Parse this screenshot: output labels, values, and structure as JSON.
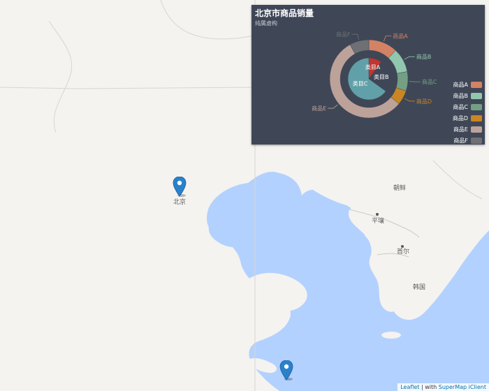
{
  "map": {
    "labels": {
      "beijing": "北京",
      "korea_north": "朝鲜",
      "pyongyang": "平壤",
      "seoul": "首尔",
      "korea_south": "韩国"
    },
    "markers": [
      "map-marker-icon",
      "map-marker-icon"
    ],
    "colors": {
      "land": "#f4f3f0",
      "sea": "#b3d1ff",
      "border": "#d7d5cf"
    }
  },
  "panel": {
    "title": "北京市商品销量",
    "subtitle": "纯属虚构"
  },
  "chart_data": {
    "type": "pie",
    "title": "北京市商品销量",
    "subtitle": "纯属虚构",
    "inner": {
      "categories": [
        "类目A",
        "类目B",
        "类目C"
      ],
      "values": [
        10,
        25,
        65
      ],
      "colors": [
        "#c23531",
        "#3f4757",
        "#61a0a8"
      ]
    },
    "outer": {
      "categories": [
        "商品A",
        "商品B",
        "商品C",
        "商品D",
        "商品E",
        "商品F"
      ],
      "values": [
        12,
        10,
        8,
        6,
        56,
        8
      ],
      "colors": [
        "#d48265",
        "#91c7ae",
        "#749f83",
        "#ca8622",
        "#bda29a",
        "#6e7074"
      ]
    },
    "legend_position": "bottom-right"
  },
  "legend": [
    {
      "label": "商品A",
      "color": "#d48265"
    },
    {
      "label": "商品B",
      "color": "#91c7ae"
    },
    {
      "label": "商品C",
      "color": "#749f83"
    },
    {
      "label": "商品D",
      "color": "#ca8622"
    },
    {
      "label": "商品E",
      "color": "#bda29a"
    },
    {
      "label": "商品F",
      "color": "#6e7074"
    }
  ],
  "attribution": {
    "leaflet": "Leaflet",
    "separator": " | with ",
    "supermap": "SuperMap iClient"
  }
}
